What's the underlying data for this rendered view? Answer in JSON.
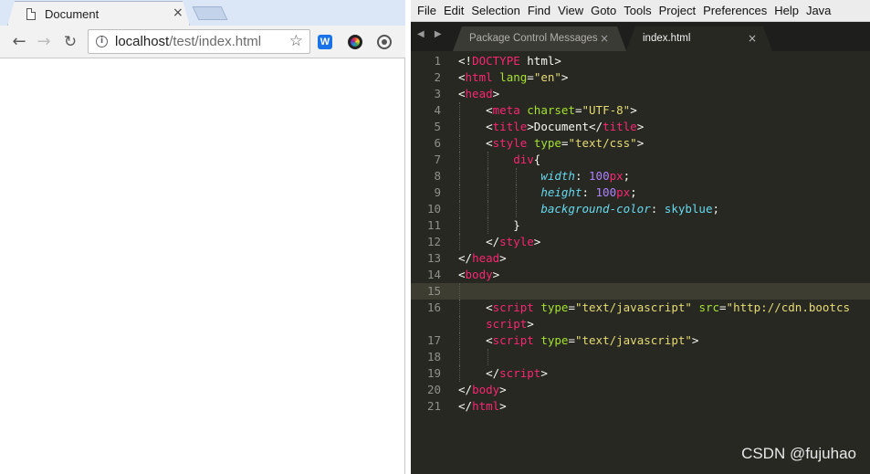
{
  "browser": {
    "tab": {
      "title": "Document",
      "close": "×"
    },
    "nav": {
      "back": "←",
      "forward": "→",
      "reload": "↻"
    },
    "omnibox": {
      "info": "i",
      "host": "localhost",
      "path": "/test/index.html",
      "star": "☆"
    },
    "extensions": {
      "w": "W"
    }
  },
  "editor": {
    "menu": [
      "File",
      "Edit",
      "Selection",
      "Find",
      "View",
      "Goto",
      "Tools",
      "Project",
      "Preferences",
      "Help",
      "Java"
    ],
    "tab_arrows": "◀ ▶",
    "tabs": [
      {
        "label": "Package Control Messages",
        "close": "×"
      },
      {
        "label": "index.html",
        "close": "×"
      }
    ],
    "lines": [
      {
        "n": "1",
        "tokens": [
          {
            "c": "",
            "t": "<!"
          },
          {
            "c": "t",
            "t": "DOCTYPE"
          },
          {
            "c": "",
            "t": " html>"
          }
        ]
      },
      {
        "n": "2",
        "tokens": [
          {
            "c": "",
            "t": "<"
          },
          {
            "c": "t",
            "t": "html"
          },
          {
            "c": "",
            "t": " "
          },
          {
            "c": "a",
            "t": "lang"
          },
          {
            "c": "",
            "t": "="
          },
          {
            "c": "s",
            "t": "\"en\""
          },
          {
            "c": "",
            "t": ">"
          }
        ]
      },
      {
        "n": "3",
        "tokens": [
          {
            "c": "",
            "t": "<"
          },
          {
            "c": "t",
            "t": "head"
          },
          {
            "c": "",
            "t": ">"
          }
        ]
      },
      {
        "n": "4",
        "tokens": [
          {
            "c": "",
            "t": "    <"
          },
          {
            "c": "t",
            "t": "meta"
          },
          {
            "c": "",
            "t": " "
          },
          {
            "c": "a",
            "t": "charset"
          },
          {
            "c": "",
            "t": "="
          },
          {
            "c": "s",
            "t": "\"UTF-8\""
          },
          {
            "c": "",
            "t": ">"
          }
        ]
      },
      {
        "n": "5",
        "tokens": [
          {
            "c": "",
            "t": "    <"
          },
          {
            "c": "t",
            "t": "title"
          },
          {
            "c": "",
            "t": ">Document</"
          },
          {
            "c": "t",
            "t": "title"
          },
          {
            "c": "",
            "t": ">"
          }
        ]
      },
      {
        "n": "6",
        "tokens": [
          {
            "c": "",
            "t": "    <"
          },
          {
            "c": "t",
            "t": "style"
          },
          {
            "c": "",
            "t": " "
          },
          {
            "c": "a",
            "t": "type"
          },
          {
            "c": "",
            "t": "="
          },
          {
            "c": "s",
            "t": "\"text/css\""
          },
          {
            "c": "",
            "t": ">"
          }
        ]
      },
      {
        "n": "7",
        "tokens": [
          {
            "c": "",
            "t": "        "
          },
          {
            "c": "t",
            "t": "div"
          },
          {
            "c": "",
            "t": "{"
          }
        ]
      },
      {
        "n": "8",
        "tokens": [
          {
            "c": "",
            "t": "            "
          },
          {
            "c": "p",
            "t": "width"
          },
          {
            "c": "",
            "t": ": "
          },
          {
            "c": "n",
            "t": "100"
          },
          {
            "c": "k",
            "t": "px"
          },
          {
            "c": "",
            "t": ";"
          }
        ]
      },
      {
        "n": "9",
        "tokens": [
          {
            "c": "",
            "t": "            "
          },
          {
            "c": "p",
            "t": "height"
          },
          {
            "c": "",
            "t": ": "
          },
          {
            "c": "n",
            "t": "100"
          },
          {
            "c": "k",
            "t": "px"
          },
          {
            "c": "",
            "t": ";"
          }
        ]
      },
      {
        "n": "10",
        "tokens": [
          {
            "c": "",
            "t": "            "
          },
          {
            "c": "p",
            "t": "background-color"
          },
          {
            "c": "",
            "t": ": "
          },
          {
            "c": "v",
            "t": "skyblue"
          },
          {
            "c": "",
            "t": ";"
          }
        ]
      },
      {
        "n": "11",
        "tokens": [
          {
            "c": "",
            "t": "        }"
          }
        ]
      },
      {
        "n": "12",
        "tokens": [
          {
            "c": "",
            "t": "    </"
          },
          {
            "c": "t",
            "t": "style"
          },
          {
            "c": "",
            "t": ">"
          }
        ]
      },
      {
        "n": "13",
        "tokens": [
          {
            "c": "",
            "t": "</"
          },
          {
            "c": "t",
            "t": "head"
          },
          {
            "c": "",
            "t": ">"
          }
        ]
      },
      {
        "n": "14",
        "tokens": [
          {
            "c": "",
            "t": "<"
          },
          {
            "c": "t",
            "t": "body"
          },
          {
            "c": "",
            "t": ">"
          }
        ]
      },
      {
        "n": "15",
        "tokens": [],
        "current": true
      },
      {
        "n": "16",
        "tokens": [
          {
            "c": "",
            "t": "    <"
          },
          {
            "c": "t",
            "t": "script"
          },
          {
            "c": "",
            "t": " "
          },
          {
            "c": "a",
            "t": "type"
          },
          {
            "c": "",
            "t": "="
          },
          {
            "c": "s",
            "t": "\"text/javascript\""
          },
          {
            "c": "",
            "t": " "
          },
          {
            "c": "a",
            "t": "src"
          },
          {
            "c": "",
            "t": "="
          },
          {
            "c": "s",
            "t": "\"http://cdn.bootcs"
          }
        ]
      },
      {
        "n": "",
        "tokens": [
          {
            "c": "",
            "t": "    "
          },
          {
            "c": "t",
            "t": "script"
          },
          {
            "c": "",
            "t": ">"
          }
        ]
      },
      {
        "n": "17",
        "tokens": [
          {
            "c": "",
            "t": "    <"
          },
          {
            "c": "t",
            "t": "script"
          },
          {
            "c": "",
            "t": " "
          },
          {
            "c": "a",
            "t": "type"
          },
          {
            "c": "",
            "t": "="
          },
          {
            "c": "s",
            "t": "\"text/javascript\""
          },
          {
            "c": "",
            "t": ">"
          }
        ]
      },
      {
        "n": "18",
        "tokens": []
      },
      {
        "n": "19",
        "tokens": [
          {
            "c": "",
            "t": "    </"
          },
          {
            "c": "t",
            "t": "script"
          },
          {
            "c": "",
            "t": ">"
          }
        ]
      },
      {
        "n": "20",
        "tokens": [
          {
            "c": "",
            "t": "</"
          },
          {
            "c": "t",
            "t": "body"
          },
          {
            "c": "",
            "t": ">"
          }
        ]
      },
      {
        "n": "21",
        "tokens": [
          {
            "c": "",
            "t": "</"
          },
          {
            "c": "t",
            "t": "html"
          },
          {
            "c": "",
            "t": ">"
          }
        ]
      }
    ]
  },
  "watermark": "CSDN @fujuhao",
  "colors": {
    "editor_bg": "#272822",
    "tag": "#f92672",
    "attribute": "#a6e22e",
    "string": "#e6db74",
    "property": "#66d9ef",
    "number": "#ae81ff"
  }
}
